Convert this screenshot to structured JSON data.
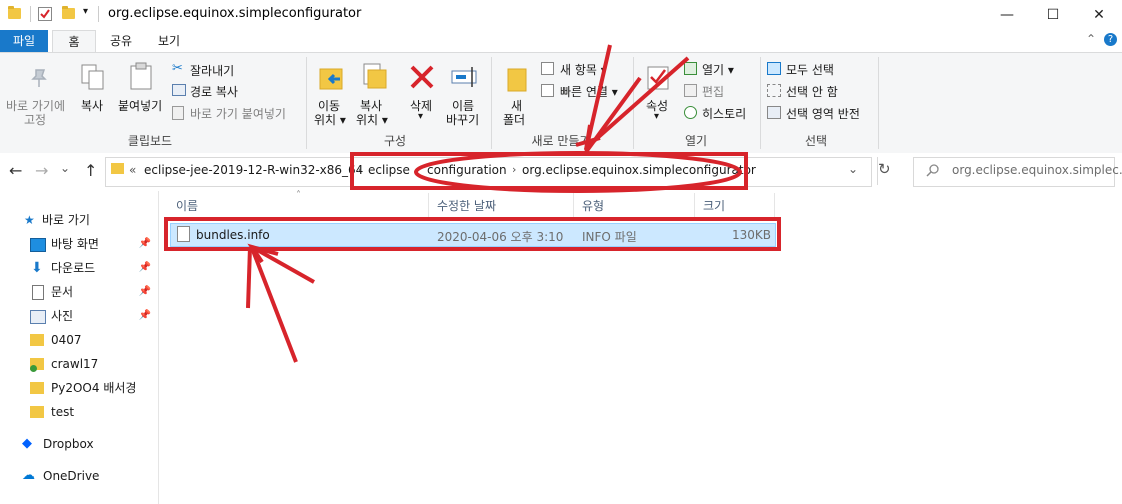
{
  "window": {
    "title": "org.eclipse.equinox.simpleconfigurator",
    "controls": {
      "minimize": "—",
      "maximize": "☐",
      "close": "✕"
    }
  },
  "ribbon_tabs": {
    "file": "파일",
    "home": "홈",
    "share": "공유",
    "view": "보기"
  },
  "ribbon": {
    "clipboard": {
      "pin_quick": [
        "바로 가기에",
        "고정"
      ],
      "copy": "복사",
      "paste": "붙여넣기",
      "cut": "잘라내기",
      "copy_path": "경로 복사",
      "paste_shortcut": "바로 가기 붙여넣기",
      "label": "클립보드"
    },
    "organize": {
      "move_to": [
        "이동",
        "위치 ▾"
      ],
      "copy_to": [
        "복사",
        "위치 ▾"
      ],
      "delete": [
        "삭제",
        "▾"
      ],
      "rename": [
        "이름",
        "바꾸기"
      ],
      "label": "구성"
    },
    "new": {
      "new_folder": [
        "새",
        "폴더"
      ],
      "new_item": "새 항목 ▾",
      "easy_access": "빠른 연결 ▾",
      "label": "새로 만들기"
    },
    "open": {
      "properties": [
        "속성",
        "▾"
      ],
      "open": "열기 ▾",
      "edit": "편집",
      "history": "히스토리",
      "label": "열기"
    },
    "select": {
      "select_all": "모두 선택",
      "select_none": "선택 안 함",
      "invert": "선택 영역 반전",
      "label": "선택"
    },
    "collapse": "⌃",
    "help": "?"
  },
  "address": {
    "overflow": "«",
    "crumbs": [
      "eclipse-jee-2019-12-R-win32-x86_64",
      "eclipse",
      "configuration",
      "org.eclipse.equinox.simpleconfigurator"
    ],
    "separator": "›",
    "dropdown": "⌄",
    "refresh": "↻"
  },
  "search": {
    "placeholder": "org.eclipse.equinox.simplec..."
  },
  "nav_buttons": {
    "back": "←",
    "forward": "→",
    "recent": "⌄",
    "up": "↑"
  },
  "nav_pane": {
    "quick_access": "바로 가기",
    "items": [
      {
        "label": "바탕 화면",
        "pinned": true
      },
      {
        "label": "다운로드",
        "pinned": true
      },
      {
        "label": "문서",
        "pinned": true
      },
      {
        "label": "사진",
        "pinned": true
      },
      {
        "label": "0407",
        "pinned": false
      },
      {
        "label": "crawl17",
        "pinned": false
      },
      {
        "label": "Py2OO4 배서경",
        "pinned": false
      },
      {
        "label": "test",
        "pinned": false
      }
    ],
    "dropbox": "Dropbox",
    "onedrive": "OneDrive"
  },
  "columns": {
    "name": "이름",
    "modified": "수정한 날짜",
    "type": "유형",
    "size": "크기"
  },
  "files": [
    {
      "name": "bundles.info",
      "modified": "2020-04-06 오후 3:10",
      "type": "INFO 파일",
      "size": "130KB"
    }
  ],
  "colors": {
    "accent": "#1979ca",
    "selection": "#cce8ff",
    "annotation": "#d7242b",
    "folder": "#f2c744"
  }
}
